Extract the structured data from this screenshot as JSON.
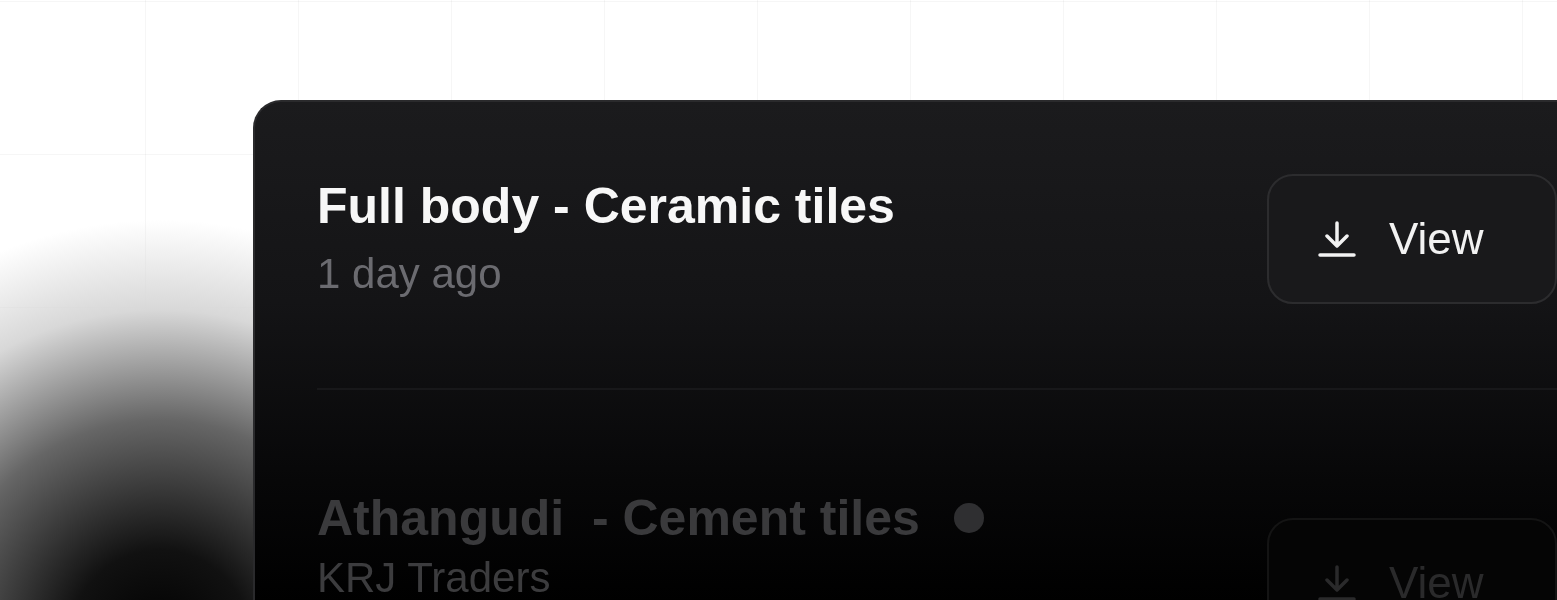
{
  "items": [
    {
      "title": "Full body - Ceramic tiles",
      "subtitle": "1 day ago",
      "dot": false,
      "button": "View"
    },
    {
      "title": "Athangudi  - Cement tiles",
      "subtitle": "KRJ Traders",
      "dot": true,
      "button": "View"
    }
  ]
}
